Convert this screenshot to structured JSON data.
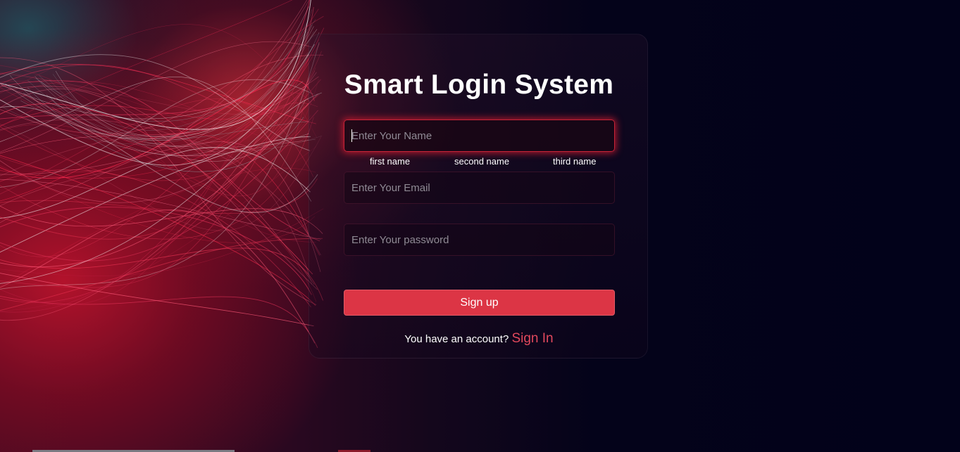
{
  "form": {
    "title": "Smart Login System",
    "name_placeholder": "Enter Your Name",
    "name_sublabels": [
      "first name",
      "second name",
      "third name"
    ],
    "email_placeholder": "Enter Your Email",
    "password_placeholder": "Enter Your password",
    "submit_label": "Sign up",
    "footer_text": "You have an account?",
    "signin_label": "Sign In"
  },
  "colors": {
    "accent": "#dc3545",
    "link": "#e0485c",
    "background": "#02021a"
  }
}
